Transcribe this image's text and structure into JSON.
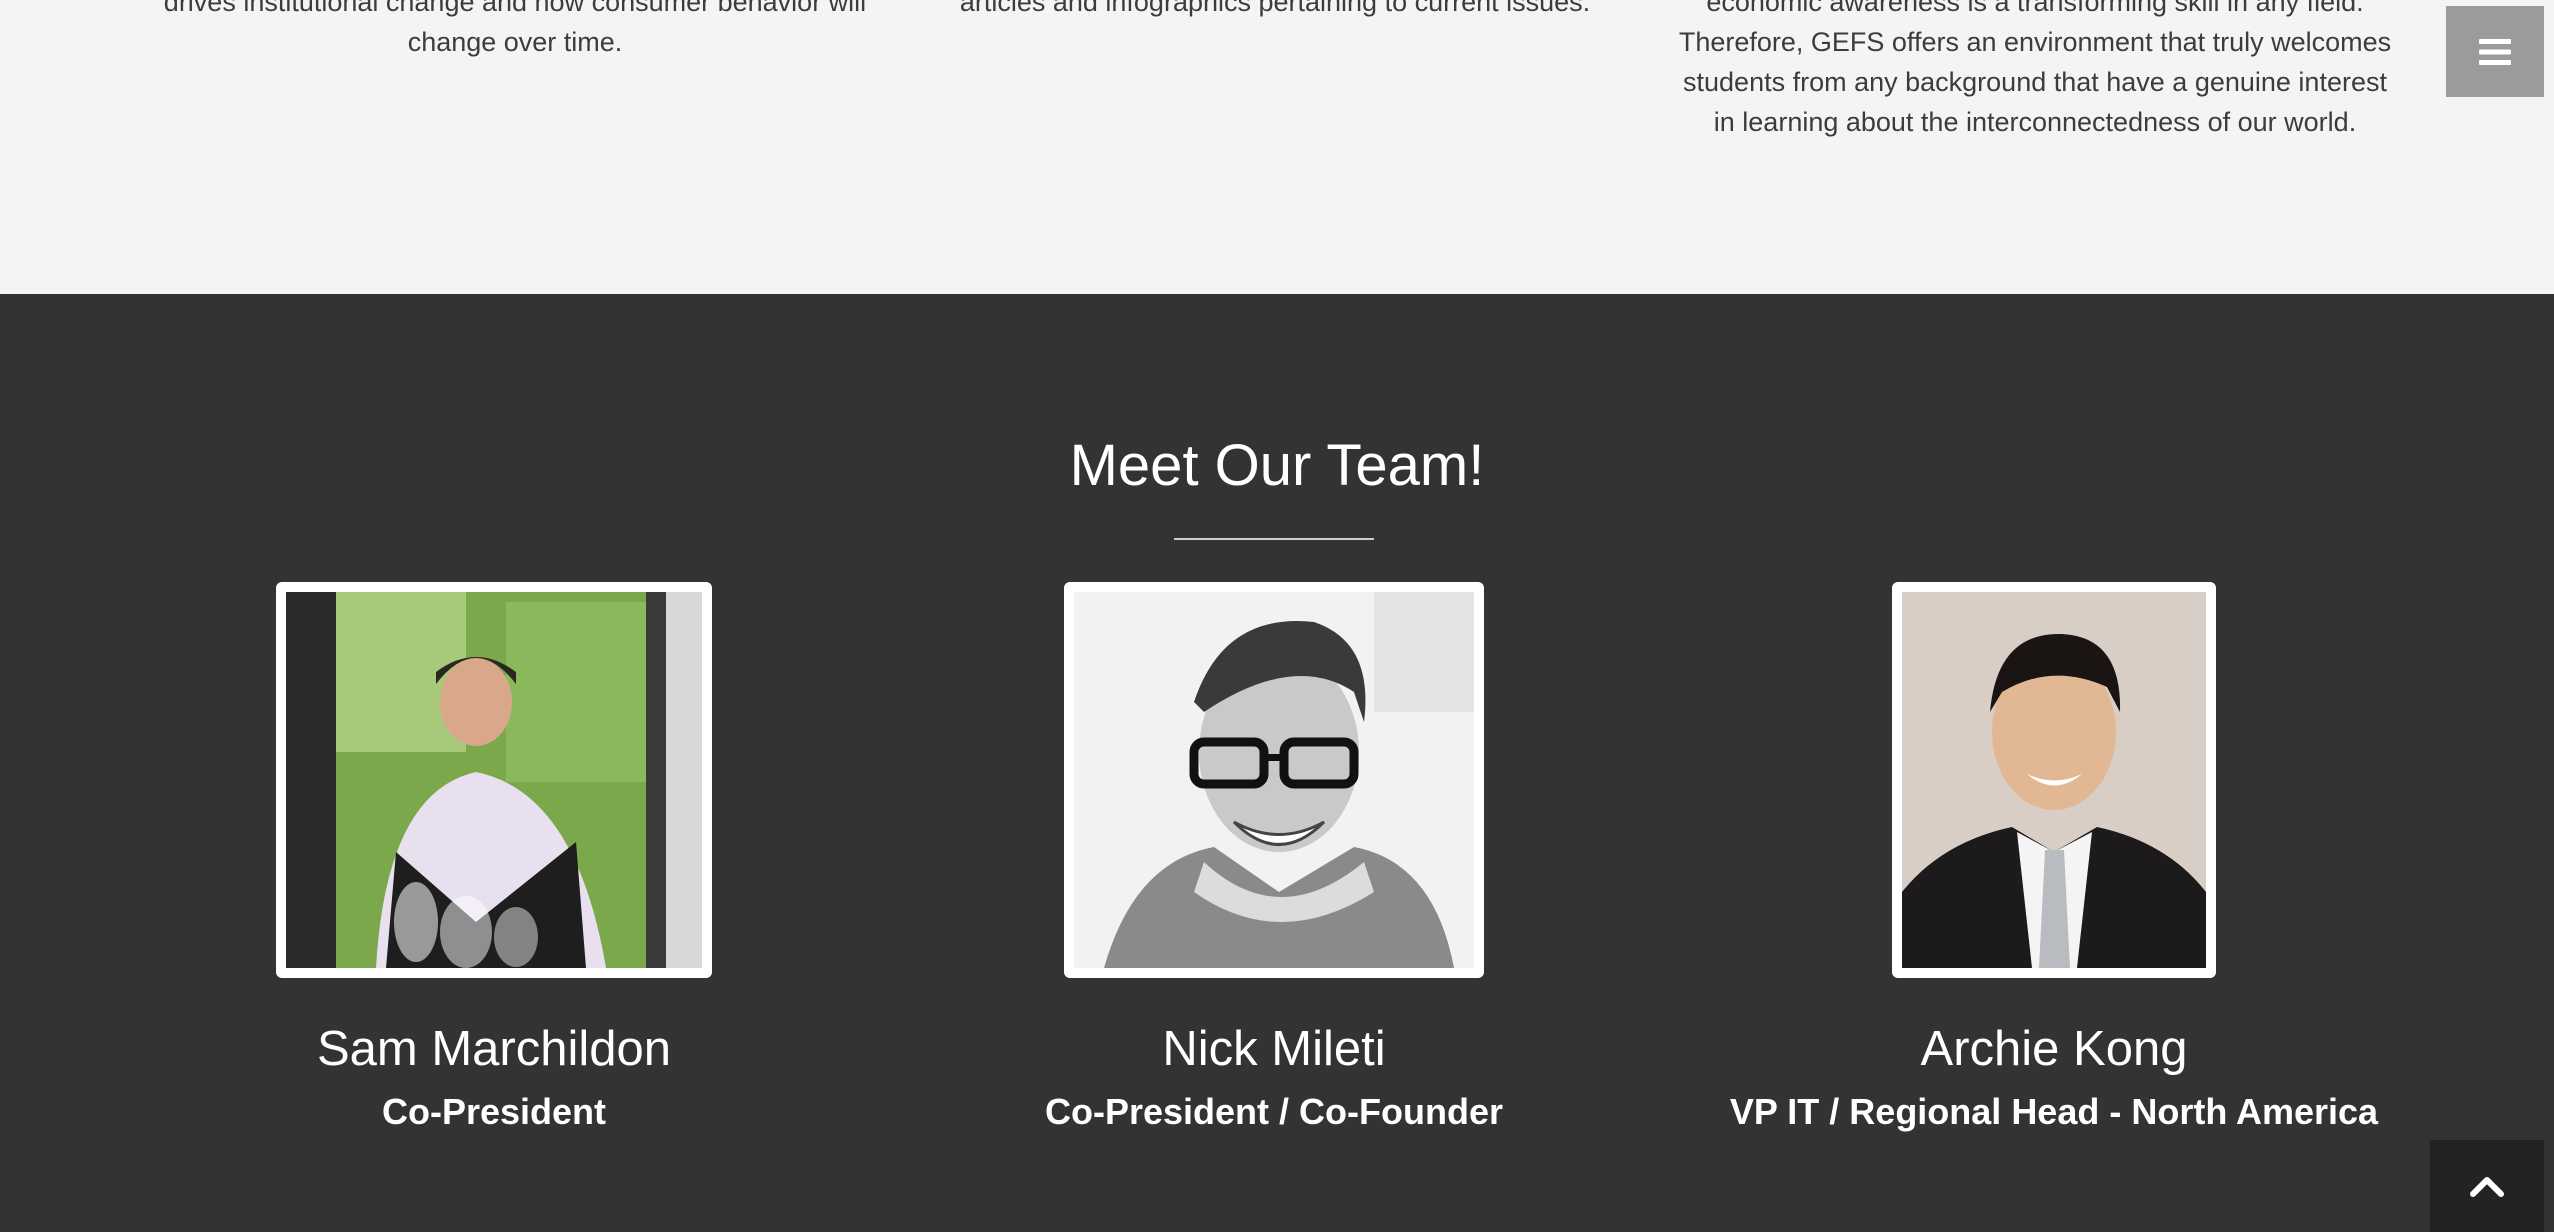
{
  "about": {
    "col1": {
      "line1": "drives institutional change and how consumer behavior will",
      "line2": "change over time."
    },
    "col2": {
      "line1": "articles and infographics pertaining to current issues."
    },
    "col3": {
      "line1": "economic awareness is a transforming skill in any field.",
      "line2": "Therefore, GEFS offers an environment that truly welcomes",
      "line3": "students from any background that have a genuine interest",
      "line4": "in learning about the interconnectedness of our world."
    }
  },
  "nav": {
    "menu_icon": "hamburger-menu-icon"
  },
  "team": {
    "title": "Meet Our Team!",
    "members": [
      {
        "name": "Sam Marchildon",
        "role": "Co-President"
      },
      {
        "name": "Nick Mileti",
        "role": "Co-President / Co-Founder"
      },
      {
        "name": "Archie Kong",
        "role": "VP IT / Regional Head - North America"
      }
    ]
  },
  "back_to_top": {
    "icon": "chevron-up-icon"
  },
  "colors": {
    "light_bg": "#f4f4f4",
    "dark_bg": "#333333",
    "menu_button": "#9b9b9b",
    "text_dark": "#3c3c3c",
    "text_light": "#ffffff"
  }
}
